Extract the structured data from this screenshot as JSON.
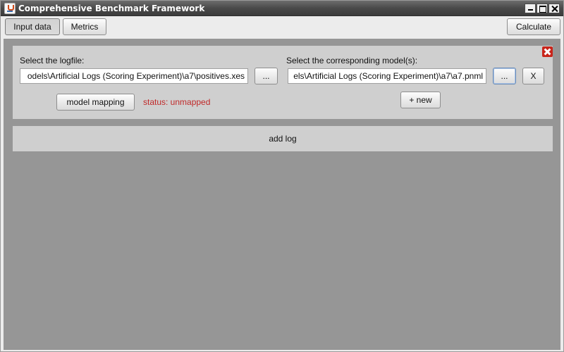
{
  "window": {
    "title": "Comprehensive Benchmark Framework"
  },
  "toolbar": {
    "tab_input": "Input data",
    "tab_metrics": "Metrics",
    "calculate": "Calculate"
  },
  "log_entry": {
    "logfile_label": "Select the logfile:",
    "logfile_path": "odels\\Artificial Logs (Scoring Experiment)\\a7\\positives.xes",
    "browse_log": "...",
    "model_label": "Select the corresponding model(s):",
    "model_path": "els\\Artificial Logs (Scoring Experiment)\\a7\\a7.pnml",
    "browse_model": "...",
    "remove_model": "X",
    "model_mapping": "model mapping",
    "status": "status: unmapped",
    "new_model": "+ new"
  },
  "add_log": "add log",
  "colors": {
    "status": "#c02a2a",
    "content_bg": "#969696",
    "panel_bg": "#cfcfcf"
  }
}
